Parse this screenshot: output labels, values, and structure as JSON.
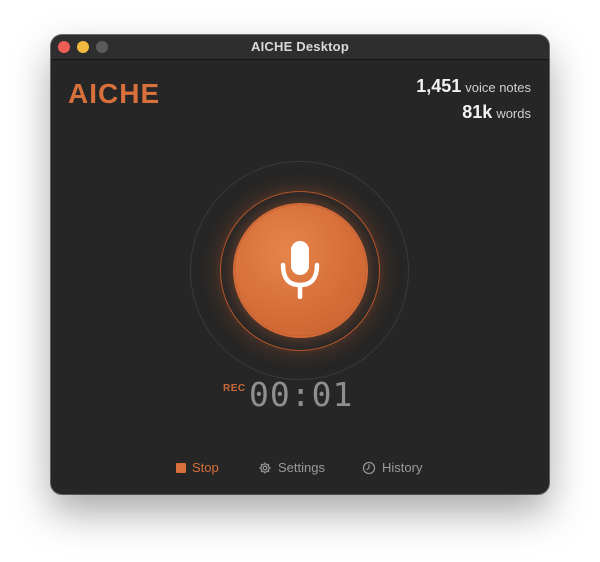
{
  "window": {
    "title": "AICHE Desktop"
  },
  "brand": {
    "logo_text": "AICHE"
  },
  "stats": {
    "voice_notes_count": "1,451",
    "voice_notes_label": "voice notes",
    "words_count": "81k",
    "words_label": "words"
  },
  "recorder": {
    "rec_label": "REC",
    "elapsed": "00:01",
    "mic_icon": "microphone-icon"
  },
  "toolbar": {
    "stop_label": "Stop",
    "stop_icon": "stop-square-icon",
    "settings_label": "Settings",
    "settings_icon": "gear-icon",
    "history_label": "History",
    "history_icon": "clock-icon"
  },
  "colors": {
    "accent": "#d7703b",
    "background": "#262626",
    "titlebar": "#2e2e2e",
    "muted_text": "#9a9a9a"
  }
}
